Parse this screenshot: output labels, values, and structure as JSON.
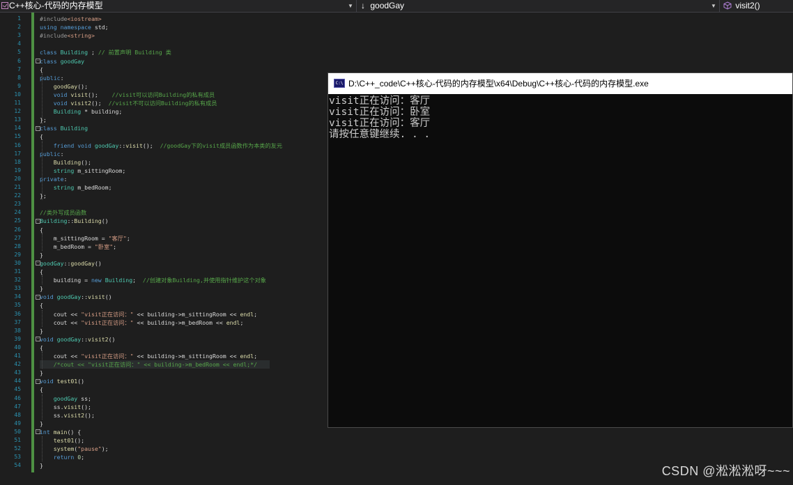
{
  "navbar": {
    "file_scope": "C++核心-代码的内存模型",
    "class_scope": "goodGay",
    "class_arrow": "↓",
    "member_scope": "visit2()"
  },
  "editor": {
    "lines": [
      [
        [
          "pp",
          "#include"
        ],
        [
          "st",
          "<iostream>"
        ]
      ],
      [
        [
          "kw",
          "using"
        ],
        [
          "",
          " "
        ],
        [
          "kw",
          "namespace"
        ],
        [
          "",
          " std;"
        ]
      ],
      [
        [
          "pp",
          "#include"
        ],
        [
          "st",
          "<string>"
        ]
      ],
      [],
      [
        [
          "kw",
          "class"
        ],
        [
          "",
          " "
        ],
        [
          "ty",
          "Building"
        ],
        [
          "",
          " ; "
        ],
        [
          "cm",
          "// 前置声明 Building 类"
        ]
      ],
      [
        [
          "kw",
          "class"
        ],
        [
          "",
          " "
        ],
        [
          "ty",
          "goodGay"
        ]
      ],
      [
        [
          "",
          "{"
        ]
      ],
      [
        [
          "kw",
          "public"
        ],
        [
          "",
          ":"
        ]
      ],
      [
        [
          "",
          "    "
        ],
        [
          "fn",
          "goodGay"
        ],
        [
          "",
          "();"
        ]
      ],
      [
        [
          "",
          "    "
        ],
        [
          "kw",
          "void"
        ],
        [
          "",
          " "
        ],
        [
          "fn",
          "visit"
        ],
        [
          "",
          "();    "
        ],
        [
          "cm",
          "//visit可以访问Building的私有成员"
        ]
      ],
      [
        [
          "",
          "    "
        ],
        [
          "kw",
          "void"
        ],
        [
          "",
          " "
        ],
        [
          "fn",
          "visit2"
        ],
        [
          "",
          "();  "
        ],
        [
          "cm",
          "//visit不可以访问Building的私有成员"
        ]
      ],
      [
        [
          "",
          "    "
        ],
        [
          "ty",
          "Building"
        ],
        [
          "",
          " * "
        ],
        [
          "var",
          "building"
        ],
        [
          "",
          ";"
        ]
      ],
      [
        [
          "",
          "};"
        ]
      ],
      [
        [
          "kw",
          "class"
        ],
        [
          "",
          " "
        ],
        [
          "ty",
          "Building"
        ]
      ],
      [
        [
          "",
          "{"
        ]
      ],
      [
        [
          "",
          "    "
        ],
        [
          "kw",
          "friend"
        ],
        [
          "",
          " "
        ],
        [
          "kw",
          "void"
        ],
        [
          "",
          " "
        ],
        [
          "ty",
          "goodGay"
        ],
        [
          "",
          "::"
        ],
        [
          "fn",
          "visit"
        ],
        [
          "",
          "();  "
        ],
        [
          "cm",
          "//goodGay下的visit成员函数作为本类的友元"
        ]
      ],
      [
        [
          "kw",
          "public"
        ],
        [
          "",
          ":"
        ]
      ],
      [
        [
          "",
          "    "
        ],
        [
          "fn",
          "Building"
        ],
        [
          "",
          "();"
        ]
      ],
      [
        [
          "",
          "    "
        ],
        [
          "ty",
          "string"
        ],
        [
          "",
          " "
        ],
        [
          "var",
          "m_sittingRoom"
        ],
        [
          "",
          ";"
        ]
      ],
      [
        [
          "kw",
          "private"
        ],
        [
          "",
          ":"
        ]
      ],
      [
        [
          "",
          "    "
        ],
        [
          "ty",
          "string"
        ],
        [
          "",
          " "
        ],
        [
          "var",
          "m_bedRoom"
        ],
        [
          "",
          ";"
        ]
      ],
      [
        [
          "",
          "};"
        ]
      ],
      [],
      [
        [
          "cm",
          "//类外写成员函数"
        ]
      ],
      [
        [
          "ty",
          "Building"
        ],
        [
          "",
          "::"
        ],
        [
          "fn",
          "Building"
        ],
        [
          "",
          "()"
        ]
      ],
      [
        [
          "",
          "{"
        ]
      ],
      [
        [
          "",
          "    "
        ],
        [
          "var",
          "m_sittingRoom"
        ],
        [
          "",
          " = "
        ],
        [
          "st",
          "\"客厅\""
        ],
        [
          "",
          ";"
        ]
      ],
      [
        [
          "",
          "    "
        ],
        [
          "var",
          "m_bedRoom"
        ],
        [
          "",
          " = "
        ],
        [
          "st",
          "\"卧室\""
        ],
        [
          "",
          ";"
        ]
      ],
      [
        [
          "",
          "}"
        ]
      ],
      [
        [
          "ty",
          "goodGay"
        ],
        [
          "",
          "::"
        ],
        [
          "fn",
          "goodGay"
        ],
        [
          "",
          "()"
        ]
      ],
      [
        [
          "",
          "{"
        ]
      ],
      [
        [
          "",
          "    "
        ],
        [
          "var",
          "building"
        ],
        [
          "",
          " = "
        ],
        [
          "kw",
          "new"
        ],
        [
          "",
          " "
        ],
        [
          "ty",
          "Building"
        ],
        [
          "",
          ";  "
        ],
        [
          "cm",
          "//创建对象Building,并使用指针维护这个对象"
        ]
      ],
      [
        [
          "",
          "}"
        ]
      ],
      [
        [
          "kw",
          "void"
        ],
        [
          "",
          " "
        ],
        [
          "ty",
          "goodGay"
        ],
        [
          "",
          "::"
        ],
        [
          "fn",
          "visit"
        ],
        [
          "",
          "()"
        ]
      ],
      [
        [
          "",
          "{"
        ]
      ],
      [
        [
          "",
          "    "
        ],
        [
          "var",
          "cout"
        ],
        [
          "",
          " << "
        ],
        [
          "st",
          "\"visit正在访问：\""
        ],
        [
          "",
          " << "
        ],
        [
          "var",
          "building"
        ],
        [
          "",
          "->"
        ],
        [
          "var",
          "m_sittingRoom"
        ],
        [
          "",
          " << "
        ],
        [
          "fn",
          "endl"
        ],
        [
          "",
          ";"
        ]
      ],
      [
        [
          "",
          "    "
        ],
        [
          "var",
          "cout"
        ],
        [
          "",
          " << "
        ],
        [
          "st",
          "\"visit正在访问：\""
        ],
        [
          "",
          " << "
        ],
        [
          "var",
          "building"
        ],
        [
          "",
          "->"
        ],
        [
          "var",
          "m_bedRoom"
        ],
        [
          "",
          " << "
        ],
        [
          "fn",
          "endl"
        ],
        [
          "",
          ";"
        ]
      ],
      [
        [
          "",
          "}"
        ]
      ],
      [
        [
          "kw",
          "void"
        ],
        [
          "",
          " "
        ],
        [
          "ty",
          "goodGay"
        ],
        [
          "",
          "::"
        ],
        [
          "fn",
          "visit2"
        ],
        [
          "",
          "()"
        ]
      ],
      [
        [
          "",
          "{"
        ]
      ],
      [
        [
          "",
          "    "
        ],
        [
          "var",
          "cout"
        ],
        [
          "",
          " << "
        ],
        [
          "st",
          "\"visit正在访问：\""
        ],
        [
          "",
          " << "
        ],
        [
          "var",
          "building"
        ],
        [
          "",
          "->"
        ],
        [
          "var",
          "m_sittingRoom"
        ],
        [
          "",
          " << "
        ],
        [
          "fn",
          "endl"
        ],
        [
          "",
          ";"
        ]
      ],
      [
        [
          "",
          "    "
        ],
        [
          "cm",
          "/*cout << \"visit正在访问：\" << building->m_bedRoom << endl;*/"
        ]
      ],
      [
        [
          "",
          "}"
        ]
      ],
      [
        [
          "kw",
          "void"
        ],
        [
          "",
          " "
        ],
        [
          "fn",
          "test01"
        ],
        [
          "",
          "()"
        ]
      ],
      [
        [
          "",
          "{"
        ]
      ],
      [
        [
          "",
          "    "
        ],
        [
          "ty",
          "goodGay"
        ],
        [
          "",
          " "
        ],
        [
          "var",
          "ss"
        ],
        [
          "",
          ";"
        ]
      ],
      [
        [
          "",
          "    "
        ],
        [
          "var",
          "ss"
        ],
        [
          "",
          "."
        ],
        [
          "fn",
          "visit"
        ],
        [
          "",
          "();"
        ]
      ],
      [
        [
          "",
          "    "
        ],
        [
          "var",
          "ss"
        ],
        [
          "",
          "."
        ],
        [
          "fn",
          "visit2"
        ],
        [
          "",
          "();"
        ]
      ],
      [
        [
          "",
          "}"
        ]
      ],
      [
        [
          "kw",
          "int"
        ],
        [
          "",
          " "
        ],
        [
          "fn",
          "main"
        ],
        [
          "",
          "() {"
        ]
      ],
      [
        [
          "",
          "    "
        ],
        [
          "fn",
          "test01"
        ],
        [
          "",
          "();"
        ]
      ],
      [
        [
          "",
          "    "
        ],
        [
          "fn",
          "system"
        ],
        [
          "",
          "("
        ],
        [
          "st",
          "\"pause\""
        ],
        [
          "",
          ");"
        ]
      ],
      [
        [
          "",
          "    "
        ],
        [
          "kw",
          "return"
        ],
        [
          "",
          " "
        ],
        [
          "num",
          "0"
        ],
        [
          "",
          ";"
        ]
      ],
      [
        [
          "",
          "}"
        ]
      ]
    ],
    "folded_lines": [
      6,
      14,
      25,
      30,
      34,
      39,
      44,
      50
    ]
  },
  "console": {
    "title": "D:\\C++_code\\C++核心-代码的内存模型\\x64\\Debug\\C++核心-代码的内存模型.exe",
    "icon_label": "C:\\",
    "output": [
      "visit正在访问：客厅",
      "visit正在访问：卧室",
      "visit正在访问：客厅",
      "请按任意键继续. . ."
    ]
  },
  "watermark": "CSDN @淞淞淞呀~~~"
}
